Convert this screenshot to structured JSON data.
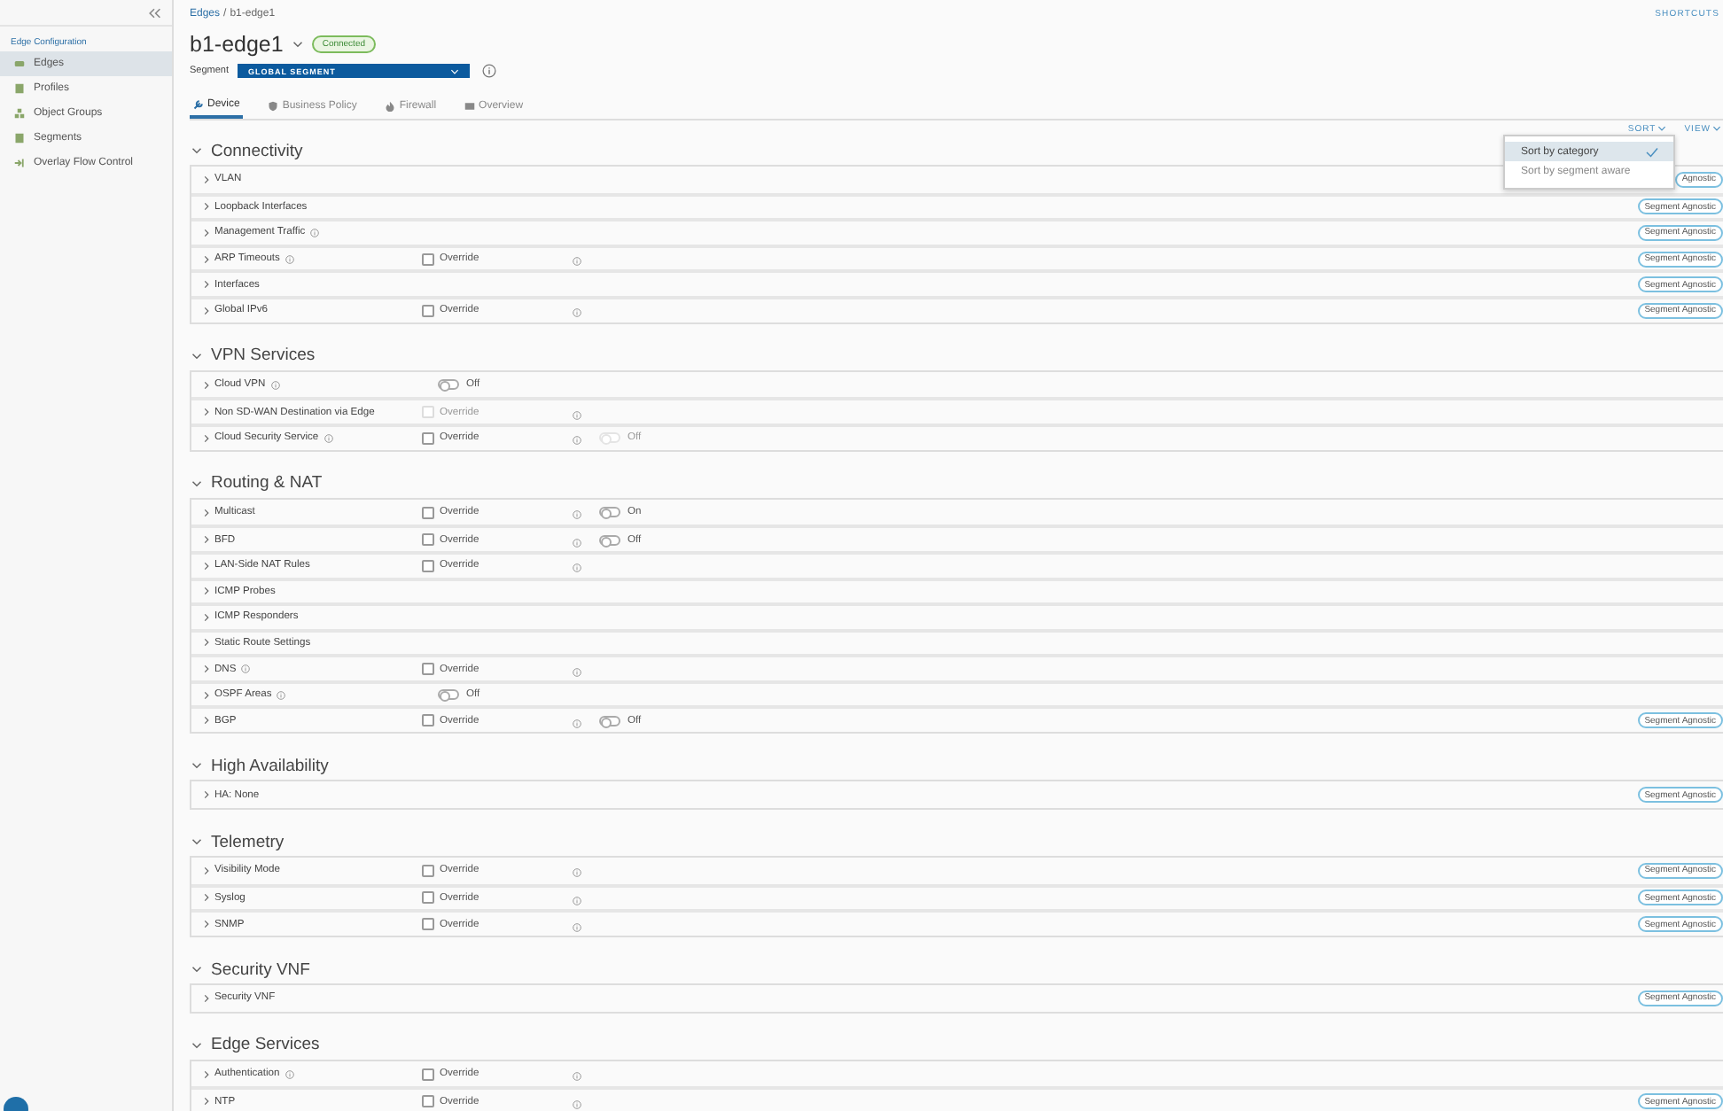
{
  "sidebar": {
    "heading": "Edge Configuration",
    "items": [
      {
        "label": "Edges",
        "selected": true
      },
      {
        "label": "Profiles",
        "selected": false
      },
      {
        "label": "Object Groups",
        "selected": false
      },
      {
        "label": "Segments",
        "selected": false
      },
      {
        "label": "Overlay Flow Control",
        "selected": false
      }
    ]
  },
  "breadcrumb": {
    "parent": "Edges",
    "separator": "/",
    "current": "b1-edge1"
  },
  "shortcuts": "SHORTCUTS",
  "title": "b1-edge1",
  "status": "Connected",
  "segment": {
    "label": "Segment",
    "value": "GLOBAL SEGMENT"
  },
  "tabs": [
    {
      "label": "Device",
      "selected": true
    },
    {
      "label": "Business Policy",
      "selected": false
    },
    {
      "label": "Firewall",
      "selected": false
    },
    {
      "label": "Overview",
      "selected": false
    }
  ],
  "toolbar": [
    "SORT",
    "VIEW"
  ],
  "sort_menu": [
    {
      "label": "Sort by category",
      "selected": true
    },
    {
      "label": "Sort by segment aware",
      "selected": false
    }
  ],
  "sections": [
    {
      "title": "Connectivity",
      "expanded": true,
      "rows": [
        {
          "name": "VLAN",
          "info": false,
          "badge": "Agnostic"
        },
        {
          "name": "Loopback Interfaces",
          "info": false,
          "badge": "Segment Agnostic"
        },
        {
          "name": "Management Traffic",
          "info": true,
          "badge": "Segment Agnostic"
        },
        {
          "name": "ARP Timeouts",
          "info": true,
          "override": {
            "label": "Override",
            "checked": false,
            "disabled": false
          },
          "badge": "Segment Agnostic"
        },
        {
          "name": "Interfaces",
          "info": false,
          "badge": "Segment Agnostic"
        },
        {
          "name": "Global IPv6",
          "info": false,
          "override": {
            "label": "Override",
            "checked": false,
            "disabled": false
          },
          "badge": "Segment Agnostic"
        }
      ]
    },
    {
      "title": "VPN Services",
      "expanded": true,
      "rows": [
        {
          "name": "Cloud VPN",
          "info": true,
          "toggle": {
            "label": "Off",
            "on": false,
            "disabled": false
          }
        },
        {
          "name": "Non SD-WAN Destination via Edge",
          "info": false,
          "override": {
            "label": "Override",
            "checked": false,
            "disabled": true
          }
        },
        {
          "name": "Cloud Security Service",
          "info": true,
          "override": {
            "label": "Override",
            "checked": false,
            "disabled": false
          },
          "toggle": {
            "label": "Off",
            "on": false,
            "disabled": true
          }
        }
      ]
    },
    {
      "title": "Routing & NAT",
      "expanded": true,
      "rows": [
        {
          "name": "Multicast",
          "info": false,
          "override": {
            "label": "Override",
            "checked": false,
            "disabled": false
          },
          "toggle": {
            "label": "On",
            "on": false,
            "disabled": false
          }
        },
        {
          "name": "BFD",
          "info": false,
          "override": {
            "label": "Override",
            "checked": false,
            "disabled": false
          },
          "toggle": {
            "label": "Off",
            "on": false,
            "disabled": false
          }
        },
        {
          "name": "LAN-Side NAT Rules",
          "info": false,
          "override": {
            "label": "Override",
            "checked": false,
            "disabled": false
          }
        },
        {
          "name": "ICMP Probes",
          "info": false
        },
        {
          "name": "ICMP Responders",
          "info": false
        },
        {
          "name": "Static Route Settings",
          "info": false
        },
        {
          "name": "DNS",
          "info": true,
          "override": {
            "label": "Override",
            "checked": false,
            "disabled": false
          }
        },
        {
          "name": "OSPF Areas",
          "info": true,
          "toggle": {
            "label": "Off",
            "on": false,
            "disabled": false
          }
        },
        {
          "name": "BGP",
          "info": false,
          "override": {
            "label": "Override",
            "checked": false,
            "disabled": false
          },
          "toggle": {
            "label": "Off",
            "on": false,
            "disabled": false
          },
          "badge": "Segment Agnostic"
        }
      ]
    },
    {
      "title": "High Availability",
      "expanded": true,
      "rows": [
        {
          "name": "HA: None",
          "info": false,
          "badge": "Segment Agnostic"
        }
      ]
    },
    {
      "title": "Telemetry",
      "expanded": true,
      "rows": [
        {
          "name": "Visibility Mode",
          "info": false,
          "override": {
            "label": "Override",
            "checked": false,
            "disabled": false
          },
          "badge": "Segment Agnostic"
        },
        {
          "name": "Syslog",
          "info": false,
          "override": {
            "label": "Override",
            "checked": false,
            "disabled": false
          },
          "badge": "Segment Agnostic"
        },
        {
          "name": "SNMP",
          "info": false,
          "override": {
            "label": "Override",
            "checked": false,
            "disabled": false
          },
          "badge": "Segment Agnostic"
        }
      ]
    },
    {
      "title": "Security VNF",
      "expanded": true,
      "rows": [
        {
          "name": "Security VNF",
          "info": false,
          "badge": "Segment Agnostic"
        }
      ]
    },
    {
      "title": "Edge Services",
      "expanded": true,
      "rows": [
        {
          "name": "Authentication",
          "info": true,
          "override": {
            "label": "Override",
            "checked": false,
            "disabled": false
          }
        },
        {
          "name": "NTP",
          "info": false,
          "override": {
            "label": "Override",
            "checked": false,
            "disabled": false
          },
          "badge": "Segment Agnostic"
        }
      ]
    }
  ]
}
